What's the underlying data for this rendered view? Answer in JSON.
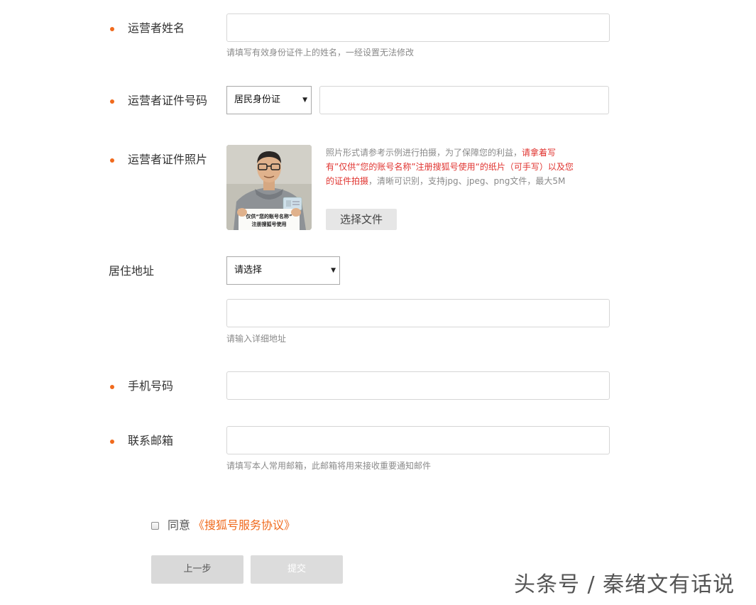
{
  "form": {
    "operator_name": {
      "label": "运营者姓名",
      "value": "",
      "hint": "请填写有效身份证件上的姓名，一经设置无法修改"
    },
    "operator_id": {
      "label": "运营者证件号码",
      "id_type_selected": "居民身份证",
      "value": ""
    },
    "operator_photo": {
      "label": "运营者证件照片",
      "desc_part1": "照片形式请参考示例进行拍摄，为了保障您的利益，",
      "desc_red": "请拿着写有”仅供“您的账号名称”注册搜狐号使用“的纸片（可手写）以及您的证件拍摄",
      "desc_part2": "，清晰可识别，支持jpg、jpeg、png文件，最大5M",
      "sample_card_line1": "仅供“您的账号名称”",
      "sample_card_line2": "注册搜狐号使用",
      "choose_file_label": "选择文件"
    },
    "address": {
      "label": "居住地址",
      "region_selected": "请选择",
      "detail_value": "",
      "detail_hint": "请输入详细地址"
    },
    "phone": {
      "label": "手机号码",
      "value": ""
    },
    "email": {
      "label": "联系邮箱",
      "value": "",
      "hint": "请填写本人常用邮箱，此邮箱将用来接收重要通知邮件"
    },
    "agreement": {
      "checked": false,
      "prefix": "同意",
      "link_text": "《搜狐号服务协议》"
    },
    "buttons": {
      "prev_label": "上一步",
      "submit_label": "提交"
    }
  },
  "watermark": "头条号 / 秦绪文有话说",
  "colors": {
    "accent": "#f06a1d",
    "required_bullet": "#f06a1d",
    "warning_red": "#e0332f",
    "hint_gray": "#8a8a8a",
    "button_gray": "#d9d9d9"
  },
  "icons": {
    "select_arrow": "triangle-down-icon",
    "required_marker": "dot-icon"
  }
}
